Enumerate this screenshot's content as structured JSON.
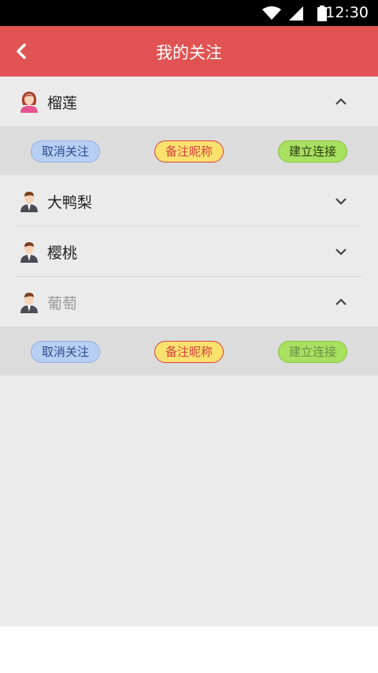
{
  "status_bar": {
    "time": "12:30",
    "icons": [
      "wifi-icon",
      "signal-icon",
      "battery-icon"
    ]
  },
  "app_bar": {
    "title": "我的关注",
    "back_icon": "chevron-left-icon",
    "color": "#e05352"
  },
  "contacts": [
    {
      "name": "榴莲",
      "avatar": "female-avatar-icon",
      "expanded": true
    },
    {
      "name": "大鸭梨",
      "avatar": "male-avatar-icon",
      "expanded": false
    },
    {
      "name": "樱桃",
      "avatar": "male-avatar-icon",
      "expanded": false
    },
    {
      "name": "葡萄",
      "avatar": "male-avatar-icon",
      "expanded": true
    }
  ],
  "actions": {
    "unfollow": "取消关注",
    "remark": "备注昵称",
    "connect": "建立连接"
  }
}
